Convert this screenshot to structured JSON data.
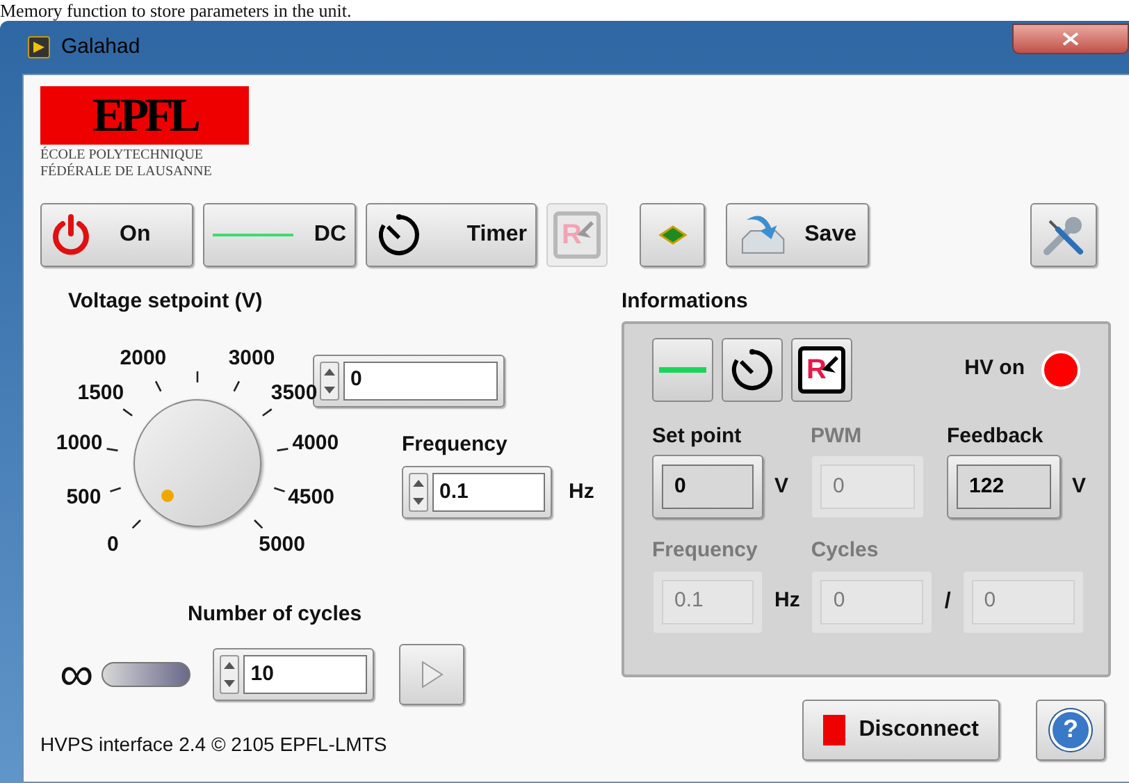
{
  "document_text": "Memory function to store parameters in the unit.",
  "window": {
    "title": "Galahad"
  },
  "logo": {
    "mark": "EPFL",
    "line_1": "ÉCOLE POLYTECHNIQUE",
    "line_2": "FÉDÉRALE DE LAUSANNE"
  },
  "toolbar": [
    {
      "kind": "power",
      "label": "On",
      "disabled": false
    },
    {
      "kind": "dc",
      "label": "DC",
      "disabled": false
    },
    {
      "kind": "timer",
      "label": "Timer",
      "disabled": false
    },
    {
      "kind": "record",
      "letter": "R",
      "disabled": true
    },
    {
      "kind": "chip",
      "disabled": false
    },
    {
      "kind": "save",
      "label": "Save",
      "disabled": false
    },
    {
      "kind": "tools",
      "disabled": false
    }
  ],
  "voltage": {
    "label": "Voltage setpoint (V)",
    "dial_labels": [
      "0",
      "500",
      "1000",
      "1500",
      "2000",
      "3000",
      "3500",
      "4000",
      "4500",
      "5000"
    ],
    "value": "0"
  },
  "frequency": {
    "label": "Frequency",
    "value": "0.1",
    "unit": "Hz"
  },
  "cycles": {
    "label": "Number of cycles",
    "infinity_symbol": "∞",
    "infinite": false,
    "value": "10"
  },
  "footer": "HVPS interface 2.4 © 2105 EPFL-LMTS",
  "info": {
    "title": "Informations",
    "indicators": [
      {
        "kind": "dc"
      },
      {
        "kind": "timer"
      },
      {
        "kind": "record",
        "letter": "R"
      }
    ],
    "hv_label": "HV on",
    "hv_on": true,
    "fields": [
      {
        "label": "Set point",
        "value": "0",
        "unit": "V",
        "disabled": false
      },
      {
        "label": "PWM",
        "value": "0",
        "disabled": true
      },
      {
        "label": "Feedback",
        "value": "122",
        "unit": "V",
        "disabled": false
      }
    ],
    "row_2": [
      {
        "label": "Frequency",
        "value": "0.1",
        "unit": "Hz",
        "disabled": true
      },
      {
        "label": "Cycles",
        "value": "0",
        "separator": "/",
        "disabled": true
      },
      {
        "value": "0",
        "disabled": true
      }
    ]
  },
  "disconnect": {
    "label": "Disconnect"
  },
  "help": {
    "glyph": "?"
  }
}
